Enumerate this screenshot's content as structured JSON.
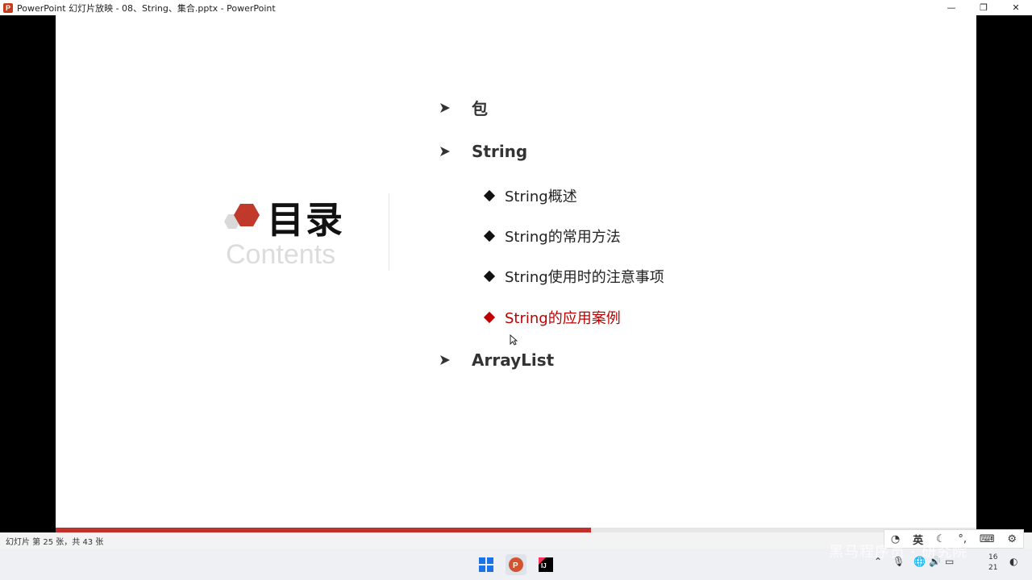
{
  "window": {
    "title": "PowerPoint 幻灯片放映  -  08、String、集合.pptx - PowerPoint",
    "app_icon_letter": "P",
    "minimize": "—",
    "restore": "❐",
    "close": "✕"
  },
  "slide": {
    "heading": "目录",
    "subheading": "Contents",
    "toc": [
      {
        "level": 1,
        "label": "包"
      },
      {
        "level": 1,
        "label": "String"
      },
      {
        "level": 2,
        "label": "String概述"
      },
      {
        "level": 2,
        "label": "String的常用方法"
      },
      {
        "level": 2,
        "label": "String使用时的注意事项"
      },
      {
        "level": 2,
        "label": "String的应用案例",
        "active": true
      },
      {
        "level": 1,
        "label": "ArrayList"
      }
    ],
    "colors": {
      "accent": "#c00000",
      "cube_red": "#c0392b",
      "cube_gray": "#d9d9d9"
    }
  },
  "status": {
    "slide_counter": "幻灯片 第 25 张，共 43 张",
    "progress": 0.581
  },
  "ime_bar": {
    "mode_label": "英",
    "icons": [
      "input-method-icon",
      "moon-icon",
      "punctuation-icon",
      "keyboard-icon",
      "gear-icon"
    ]
  },
  "taskbar": {
    "apps": [
      "windows-start-icon",
      "powerpoint-icon",
      "intellij-icon"
    ],
    "clock_top": "16",
    "clock_bottom": "21"
  },
  "watermark": "黑马程序员 · 研究院"
}
